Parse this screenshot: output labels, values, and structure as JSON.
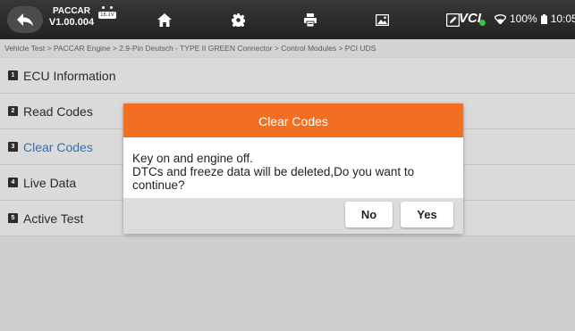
{
  "header": {
    "version_line1": "PACCAR",
    "version_line2": "V1.00.004",
    "car_badge": "16.1V",
    "vci_label": "VCI",
    "battery": "100%",
    "time": "10:05"
  },
  "breadcrumb": "Vehicle Test > PACCAR Engine > 2.9-Pin Deutsch - TYPE II GREEN Connector > Control Modules > PCI UDS",
  "menu": {
    "items": [
      {
        "num": "1",
        "label": "ECU Information"
      },
      {
        "num": "2",
        "label": "Read Codes"
      },
      {
        "num": "3",
        "label": "Clear Codes"
      },
      {
        "num": "4",
        "label": "Live Data"
      },
      {
        "num": "5",
        "label": "Active Test"
      }
    ]
  },
  "dialog": {
    "title": "Clear Codes",
    "line1": "Key on and engine off.",
    "line2": "DTCs and freeze data will be deleted,Do you want to continue?",
    "no_label": "No",
    "yes_label": "Yes"
  },
  "colors": {
    "accent": "#f26e21",
    "selected_text": "#2f72b8",
    "topbar": "#2a2a2a",
    "vci_connected": "#41c043"
  }
}
